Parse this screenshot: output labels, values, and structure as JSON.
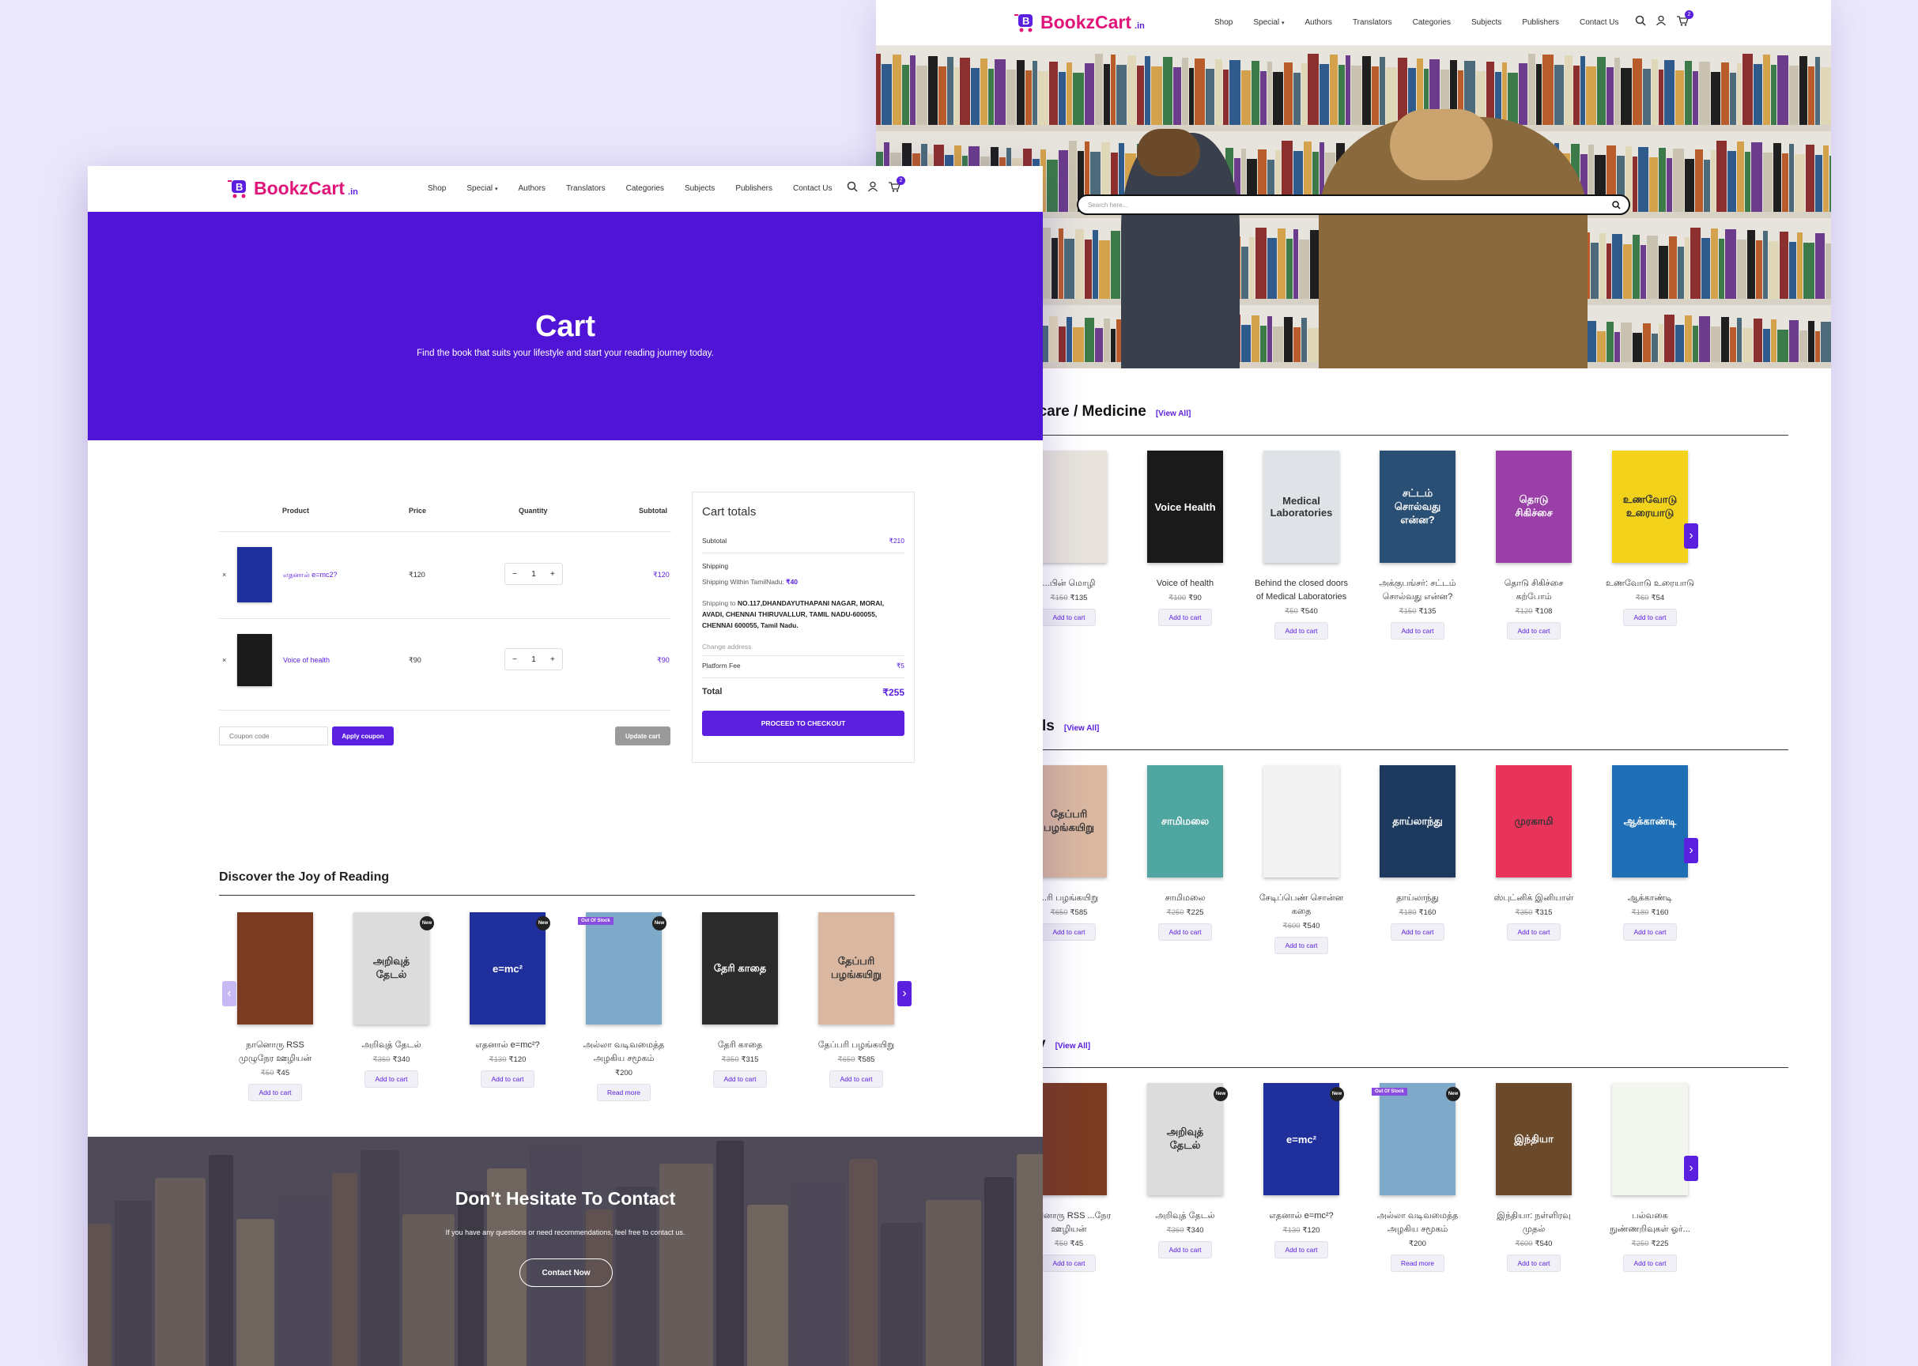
{
  "brand": {
    "name": "BookzCart",
    "suffix": ".in"
  },
  "nav": [
    "Shop",
    "Special",
    "Authors",
    "Translators",
    "Categories",
    "Subjects",
    "Publishers",
    "Contact Us"
  ],
  "cart_count": "2",
  "colors": {
    "accent": "#5b1fe0",
    "hero": "#4f14d6",
    "brand_pink": "#e0157a"
  },
  "back": {
    "search_placeholder": "Search here...",
    "sections": [
      {
        "title": "hcare / Medicine",
        "view_all": "[View All]",
        "books": [
          {
            "name": "...பின் மொழி",
            "old": "₹150",
            "price": "₹135",
            "action": "Add to cart",
            "color": "#e8e3dc",
            "cover": ""
          },
          {
            "name": "Voice of health",
            "old": "₹100",
            "price": "₹90",
            "action": "Add to cart",
            "color": "#1a1a1a",
            "cover": "Voice Health"
          },
          {
            "name": "Behind the closed doors of Medical Laboratories",
            "old": "₹50",
            "price": "₹540",
            "action": "Add to cart",
            "color": "#dfe2e6",
            "cover": "Medical Laboratories"
          },
          {
            "name": "அக்குபங்சர்: சட்டம் சொல்வது என்ன?",
            "old": "₹150",
            "price": "₹135",
            "action": "Add to cart",
            "color": "#2a4f74",
            "cover": "சட்டம் சொல்வது என்ன?"
          },
          {
            "name": "தொடு சிகிச்சை கற்போம்",
            "old": "₹120",
            "price": "₹108",
            "action": "Add to cart",
            "color": "#9a3fa8",
            "cover": "தொடு சிகிச்சை"
          },
          {
            "name": "உணவோடு உரையாடு",
            "old": "₹60",
            "price": "₹54",
            "action": "Add to cart",
            "color": "#f2d21a",
            "cover": "உணவோடு உரையாடு"
          }
        ]
      },
      {
        "title": "ls",
        "view_all": "[View All]",
        "books": [
          {
            "name": "...ரி பழங்கயிறு",
            "old": "₹650",
            "price": "₹585",
            "action": "Add to cart",
            "color": "#d9b7a0",
            "cover": "தேப்பரி பழங்கயிறு"
          },
          {
            "name": "சாமிமலை",
            "old": "₹250",
            "price": "₹225",
            "action": "Add to cart",
            "color": "#4fa6a0",
            "cover": "சாமிமலை"
          },
          {
            "name": "சேடிப்பெண் சொன்ன கதை",
            "old": "₹600",
            "price": "₹540",
            "action": "Add to cart",
            "color": "#f3f3f3",
            "cover": ""
          },
          {
            "name": "தாய்லாந்து",
            "old": "₹180",
            "price": "₹160",
            "action": "Add to cart",
            "color": "#1d3a5e",
            "cover": "தாய்லாந்து"
          },
          {
            "name": "ஸ்புட்னிக் இனியாள்",
            "old": "₹350",
            "price": "₹315",
            "action": "Add to cart",
            "color": "#e8345a",
            "cover": "முரகாமி"
          },
          {
            "name": "ஆக்காண்டி",
            "old": "₹180",
            "price": "₹160",
            "action": "Add to cart",
            "color": "#1e6fb6",
            "cover": "ஆக்காண்டி"
          }
        ]
      },
      {
        "title": "y",
        "view_all": "[View All]",
        "books": [
          {
            "name": "நானொரு RSS ...நேர ஊழியன்",
            "old": "₹50",
            "price": "₹45",
            "action": "Add to cart",
            "color": "#7a3b22",
            "cover": ""
          },
          {
            "name": "அறிவுத் தேடல்",
            "old": "₹360",
            "price": "₹340",
            "action": "Add to cart",
            "color": "#dcdcdc",
            "cover": "அறிவுத் தேடல்",
            "tag": "New"
          },
          {
            "name": "எதனால் e=mc²?",
            "old": "₹130",
            "price": "₹120",
            "action": "Add to cart",
            "color": "#1f2f9c",
            "cover": "e=mc²",
            "tag": "New"
          },
          {
            "name": "அல்லா வடிவமைத்த அழகிய சமூகம்",
            "old": "",
            "price": "₹200",
            "action": "Read more",
            "color": "#7fa9c9",
            "cover": "",
            "tag": "New",
            "stock": "Out Of Stock"
          },
          {
            "name": "இந்தியா: நள்ளிரவு முதல்",
            "old": "₹600",
            "price": "₹540",
            "action": "Add to cart",
            "color": "#6b4a2c",
            "cover": "இந்தியா"
          },
          {
            "name": "பல்வகை நுண்ணறிவுகள் ஓர்...",
            "old": "₹250",
            "price": "₹225",
            "action": "Add to cart",
            "color": "#f3f6ee",
            "cover": ""
          }
        ]
      }
    ]
  },
  "front": {
    "hero": {
      "title": "Cart",
      "subtitle": "Find the book that suits your lifestyle and start your reading journey today."
    },
    "table_headers": {
      "product": "Product",
      "price": "Price",
      "quantity": "Quantity",
      "subtotal": "Subtotal"
    },
    "items": [
      {
        "remove": "×",
        "name": "எதனால் e=mc2?",
        "price": "₹120",
        "qty": "1",
        "subtotal": "₹120",
        "color": "#1f2f9c"
      },
      {
        "remove": "×",
        "name": "Voice of health",
        "price": "₹90",
        "qty": "1",
        "subtotal": "₹90",
        "color": "#1a1a1a"
      }
    ],
    "coupon_placeholder": "Coupon code",
    "apply_coupon": "Apply coupon",
    "update_cart": "Update cart",
    "totals": {
      "title": "Cart totals",
      "subtotal_label": "Subtotal",
      "subtotal": "₹210",
      "shipping_label": "Shipping",
      "shipping_note": "Shipping Within TamilNadu:",
      "shipping_value": "₹40",
      "ship_to_prefix": "Shipping to",
      "ship_to": "NO.117,DHANDAYUTHAPANI NAGAR, MORAI, AVADI, CHENNAI THIRUVALLUR, TAMIL NADU-600055, CHENNAI 600055, Tamil Nadu.",
      "change_address": "Change address",
      "platform_label": "Platform Fee",
      "platform": "₹5",
      "total_label": "Total",
      "total": "₹255",
      "checkout": "PROCEED TO CHECKOUT"
    },
    "discover": {
      "title": "Discover the Joy of Reading",
      "books": [
        {
          "name": "நானொரு RSS முழுநேர ஊழியன்",
          "old": "₹50",
          "price": "₹45",
          "action": "Add to cart",
          "color": "#7a3b22",
          "cover": ""
        },
        {
          "name": "அறிவுத் தேடல்",
          "old": "₹360",
          "price": "₹340",
          "action": "Add to cart",
          "color": "#dcdcdc",
          "cover": "அறிவுத் தேடல்",
          "tag": "New"
        },
        {
          "name": "எதனால் e=mc²?",
          "old": "₹130",
          "price": "₹120",
          "action": "Add to cart",
          "color": "#1f2f9c",
          "cover": "e=mc²",
          "tag": "New"
        },
        {
          "name": "அல்லா வடிவமைத்த அழகிய சமூகம்",
          "old": "",
          "price": "₹200",
          "action": "Read more",
          "color": "#7fa9c9",
          "cover": "",
          "tag": "New",
          "stock": "Out Of Stock"
        },
        {
          "name": "தேரி காதை",
          "old": "₹350",
          "price": "₹315",
          "action": "Add to cart",
          "color": "#2b2b2b",
          "cover": "தேரி காதை"
        },
        {
          "name": "தேப்பரி பழங்கயிறு",
          "old": "₹650",
          "price": "₹585",
          "action": "Add to cart",
          "color": "#d9b7a0",
          "cover": "தேப்பரி பழங்கயிறு"
        }
      ]
    },
    "contact": {
      "title": "Don't Hesitate To Contact",
      "text": "If you have any questions or need recommendations, feel free to contact us.",
      "button": "Contact Now"
    }
  }
}
